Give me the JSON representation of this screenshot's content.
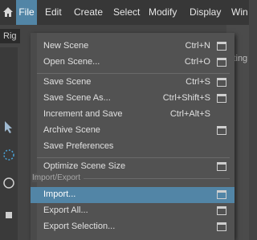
{
  "menubar": {
    "items": [
      "File",
      "Edit",
      "Create",
      "Select",
      "Modify",
      "Display",
      "Win"
    ],
    "active_index": 0,
    "active_color": "#5285a6",
    "home_icon": "home-icon"
  },
  "background": {
    "rig_label": "Rig",
    "right_text": "iting"
  },
  "file_menu": {
    "items": [
      {
        "label": "New Scene",
        "shortcut": "Ctrl+N",
        "options": true
      },
      {
        "label": "Open Scene...",
        "shortcut": "Ctrl+O",
        "options": true
      },
      {
        "label": "Save Scene",
        "shortcut": "Ctrl+S",
        "options": true
      },
      {
        "label": "Save Scene As...",
        "shortcut": "Ctrl+Shift+S",
        "options": true
      },
      {
        "label": "Increment and Save",
        "shortcut": "Ctrl+Alt+S",
        "options": false
      },
      {
        "label": "Archive Scene",
        "shortcut": "",
        "options": true
      },
      {
        "label": "Save Preferences",
        "shortcut": "",
        "options": false
      },
      {
        "label": "Optimize Scene Size",
        "shortcut": "",
        "options": true
      },
      {
        "label": "Import...",
        "shortcut": "",
        "options": true
      },
      {
        "label": "Export All...",
        "shortcut": "",
        "options": true
      },
      {
        "label": "Export Selection...",
        "shortcut": "",
        "options": true
      }
    ],
    "section_title": "Import/Export",
    "highlighted_item": "Import..."
  }
}
